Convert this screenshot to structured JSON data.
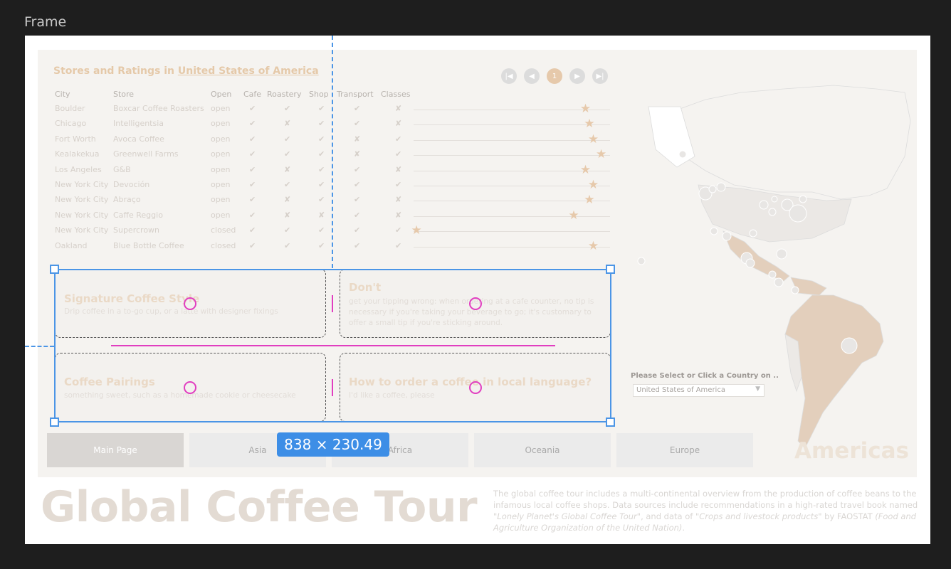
{
  "frame_label": "Frame",
  "dashboard": {
    "title_prefix": "Stores and Ratings in ",
    "title_country": "United States of America",
    "pager": {
      "first_icon": "first-page-icon",
      "prev_icon": "prev-page-icon",
      "current": "1",
      "next_icon": "next-page-icon",
      "last_icon": "last-page-icon"
    },
    "columns": [
      "City",
      "Store",
      "Open",
      "Cafe",
      "Roastery",
      "Shop",
      "Transport",
      "Classes"
    ],
    "rows": [
      {
        "city": "Boulder",
        "store": "Boxcar Coffee Roasters",
        "open": "open",
        "cafe": "✔",
        "roastery": "✔",
        "shop": "✔",
        "transport": "✔",
        "classes": "✘",
        "rating": 4.4
      },
      {
        "city": "Chicago",
        "store": "Intelligentsia",
        "open": "open",
        "cafe": "✔",
        "roastery": "✘",
        "shop": "✔",
        "transport": "✔",
        "classes": "✘",
        "rating": 4.5
      },
      {
        "city": "Fort Worth",
        "store": "Avoca Coffee",
        "open": "open",
        "cafe": "✔",
        "roastery": "✔",
        "shop": "✔",
        "transport": "✘",
        "classes": "✔",
        "rating": 4.6
      },
      {
        "city": "Kealakekua",
        "store": "Greenwell Farms",
        "open": "open",
        "cafe": "✔",
        "roastery": "✔",
        "shop": "✔",
        "transport": "✘",
        "classes": "✔",
        "rating": 4.8
      },
      {
        "city": "Los Angeles",
        "store": "G&B",
        "open": "open",
        "cafe": "✔",
        "roastery": "✘",
        "shop": "✔",
        "transport": "✔",
        "classes": "✘",
        "rating": 4.4
      },
      {
        "city": "New York City",
        "store": "Devoción",
        "open": "open",
        "cafe": "✔",
        "roastery": "✔",
        "shop": "✔",
        "transport": "✔",
        "classes": "✔",
        "rating": 4.6
      },
      {
        "city": "New York City",
        "store": "Abraço",
        "open": "open",
        "cafe": "✔",
        "roastery": "✘",
        "shop": "✔",
        "transport": "✔",
        "classes": "✘",
        "rating": 4.5
      },
      {
        "city": "New York City",
        "store": "Caffe Reggio",
        "open": "open",
        "cafe": "✔",
        "roastery": "✘",
        "shop": "✘",
        "transport": "✔",
        "classes": "✘",
        "rating": 4.1
      },
      {
        "city": "New York City",
        "store": "Supercrown",
        "open": "closed",
        "cafe": "✔",
        "roastery": "✔",
        "shop": "✔",
        "transport": "✔",
        "classes": "✔",
        "rating": 0.1
      },
      {
        "city": "Oakland",
        "store": "Blue Bottle Coffee",
        "open": "closed",
        "cafe": "✔",
        "roastery": "✔",
        "shop": "✔",
        "transport": "✔",
        "classes": "✔",
        "rating": 4.6
      }
    ],
    "cards": [
      {
        "title": "Signature Coffee Style",
        "text": "Drip coffee in a to-go cup, or a latte with designer fixings"
      },
      {
        "title": "Don't",
        "text": "get your tipping wrong: when ordering at a cafe counter, no tip is necessary if you're taking your beverage to go; it's customary to offer a small tip if you're sticking around."
      },
      {
        "title": "Coffee Pairings",
        "text": "something sweet, such as a homemade cookie or cheesecake"
      },
      {
        "title": "How to order a coffee in local language?",
        "text": "I'd like a coffee, please"
      }
    ],
    "nav": [
      "Main Page",
      "Asia",
      "Africa",
      "Oceania",
      "Europe"
    ],
    "region_title": "Americas",
    "country_select": {
      "label": "Please Select or Click a Country on ..",
      "value": "United States of America"
    }
  },
  "footer": {
    "big_title": "Global Coffee Tour",
    "desc_1": "The global coffee tour includes a multi-continental overview from the production of coffee beans to the infamous local coffee shops. Data sources include recommendations in a high-rated travel book named ",
    "desc_book": "\"Lonely Planet's Global Coffee Tour\"",
    "desc_2": ", and data of ",
    "desc_data": "\"Crops and livestock products\"",
    "desc_3": " by FAOSTAT ",
    "desc_org": "(Food and Agriculture Organization of the United Nation)",
    "desc_4": "."
  },
  "selection": {
    "dimension_label": "838 × 230.49"
  },
  "colors": {
    "accent": "#e6c9ab",
    "selection": "#4b95e6",
    "spacing": "#e13ec0"
  }
}
